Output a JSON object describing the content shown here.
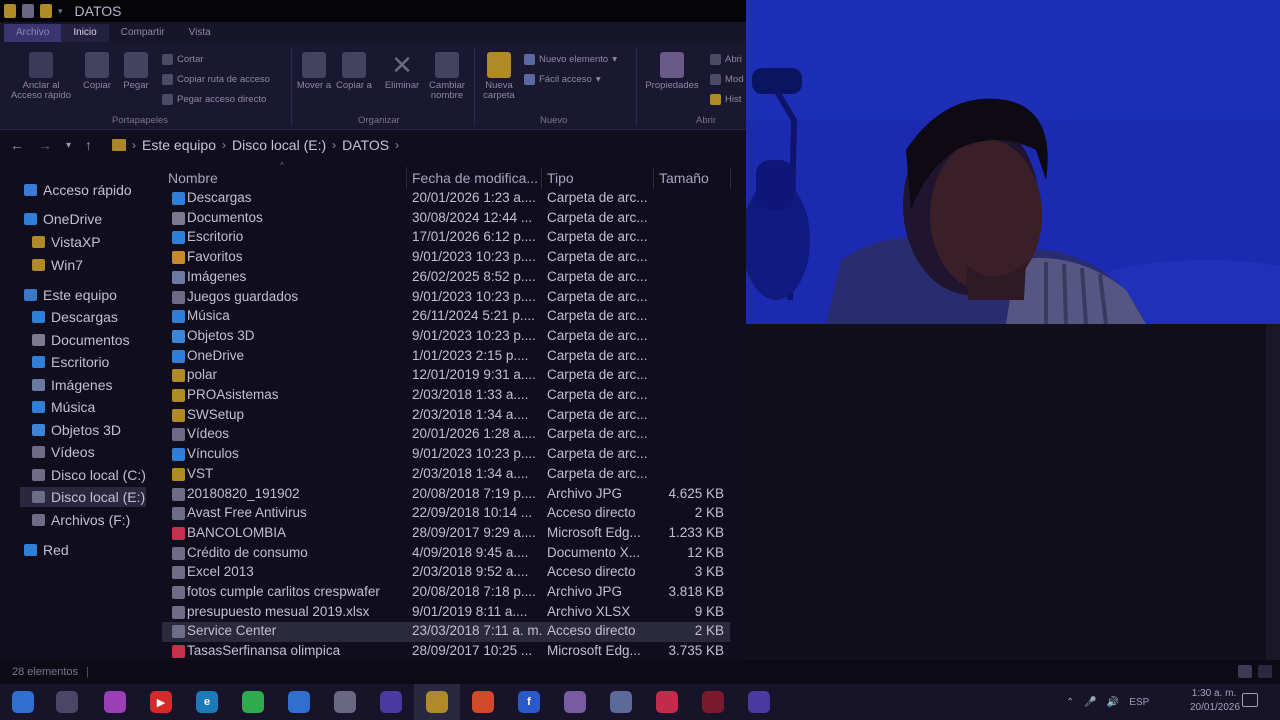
{
  "window": {
    "title": "DATOS"
  },
  "ribbon_tabs": [
    "Archivo",
    "Inicio",
    "Compartir",
    "Vista"
  ],
  "ribbon": {
    "anclar": "Anclar al Acceso rápido",
    "copiar": "Copiar",
    "pegar": "Pegar",
    "cortar": "Cortar",
    "copiar_ruta": "Copiar ruta de acceso",
    "pegar_acceso": "Pegar acceso directo",
    "grupo_portapapeles": "Portapapeles",
    "mover": "Mover a",
    "copiar_a": "Copiar a",
    "eliminar": "Eliminar",
    "cambiar": "Cambiar nombre",
    "grupo_organizar": "Organizar",
    "nueva_carpeta": "Nueva carpeta",
    "nuevo_elemento": "Nuevo elemento",
    "facil_acceso": "Fácil acceso",
    "grupo_nuevo": "Nuevo",
    "propiedades": "Propiedades",
    "abrir_small": "Abri",
    "modificar_small": "Mod",
    "historial_small": "Hist",
    "grupo_abrir": "Abrir"
  },
  "breadcrumb": [
    "Este equipo",
    "Disco local (E:)",
    "DATOS"
  ],
  "nav": [
    {
      "label": "Acceso rápido",
      "icon": "star-icon",
      "color": "#3a7bd5"
    },
    {
      "label": "OneDrive",
      "icon": "cloud-icon",
      "color": "#2f7fd8"
    },
    {
      "label": "VistaXP",
      "icon": "folder-icon",
      "color": "#b08a26"
    },
    {
      "label": "Win7",
      "icon": "folder-icon",
      "color": "#b08a26"
    },
    {
      "label": "Este equipo",
      "icon": "computer-icon",
      "color": "#3a78c8"
    },
    {
      "label": "Descargas",
      "icon": "download-icon",
      "color": "#2f7fd8"
    },
    {
      "label": "Documentos",
      "icon": "document-icon",
      "color": "#7b7892"
    },
    {
      "label": "Escritorio",
      "icon": "desktop-icon",
      "color": "#2f7fd8"
    },
    {
      "label": "Imágenes",
      "icon": "image-icon",
      "color": "#6b7aa0"
    },
    {
      "label": "Música",
      "icon": "music-icon",
      "color": "#2f7fd8"
    },
    {
      "label": "Objetos 3D",
      "icon": "cube-icon",
      "color": "#3b86d8"
    },
    {
      "label": "Vídeos",
      "icon": "video-icon",
      "color": "#6c6a86"
    },
    {
      "label": "Disco local (C:)",
      "icon": "drive-icon",
      "color": "#6f6c88"
    },
    {
      "label": "Disco local (E:)",
      "icon": "drive-icon",
      "color": "#6f6c88"
    },
    {
      "label": "Archivos (F:)",
      "icon": "drive-icon",
      "color": "#6f6c88"
    },
    {
      "label": "Red",
      "icon": "network-icon",
      "color": "#2f7fd8"
    }
  ],
  "columns": {
    "name": "Nombre",
    "date": "Fecha de modifica...",
    "type": "Tipo",
    "size": "Tamaño"
  },
  "files": [
    {
      "name": "Descargas",
      "date": "20/01/2026 1:23 a....",
      "type": "Carpeta de arc...",
      "size": "",
      "icon": "download-icon",
      "color": "#2f7fd8"
    },
    {
      "name": "Documentos",
      "date": "30/08/2024 12:44 ...",
      "type": "Carpeta de arc...",
      "size": "",
      "icon": "document-icon",
      "color": "#7b7892"
    },
    {
      "name": "Escritorio",
      "date": "17/01/2026 6:12 p....",
      "type": "Carpeta de arc...",
      "size": "",
      "icon": "desktop-icon",
      "color": "#2f7fd8"
    },
    {
      "name": "Favoritos",
      "date": "9/01/2023 10:23 p....",
      "type": "Carpeta de arc...",
      "size": "",
      "icon": "star-icon",
      "color": "#c8892a"
    },
    {
      "name": "Imágenes",
      "date": "26/02/2025 8:52 p....",
      "type": "Carpeta de arc...",
      "size": "",
      "icon": "image-icon",
      "color": "#6b7aa0"
    },
    {
      "name": "Juegos guardados",
      "date": "9/01/2023 10:23 p....",
      "type": "Carpeta de arc...",
      "size": "",
      "icon": "game-icon",
      "color": "#6c6a86"
    },
    {
      "name": "Música",
      "date": "26/11/2024 5:21 p....",
      "type": "Carpeta de arc...",
      "size": "",
      "icon": "music-icon",
      "color": "#2f7fd8"
    },
    {
      "name": "Objetos 3D",
      "date": "9/01/2023 10:23 p....",
      "type": "Carpeta de arc...",
      "size": "",
      "icon": "cube-icon",
      "color": "#3b86d8"
    },
    {
      "name": "OneDrive",
      "date": "1/01/2023 2:15 p....",
      "type": "Carpeta de arc...",
      "size": "",
      "icon": "cloud-icon",
      "color": "#2f7fd8"
    },
    {
      "name": "polar",
      "date": "12/01/2019 9:31 a....",
      "type": "Carpeta de arc...",
      "size": "",
      "icon": "folder-icon",
      "color": "#b08a26"
    },
    {
      "name": "PROAsistemas",
      "date": "2/03/2018 1:33 a....",
      "type": "Carpeta de arc...",
      "size": "",
      "icon": "folder-icon",
      "color": "#b08a26"
    },
    {
      "name": "SWSetup",
      "date": "2/03/2018 1:34 a....",
      "type": "Carpeta de arc...",
      "size": "",
      "icon": "folder-icon",
      "color": "#b08a26"
    },
    {
      "name": "Vídeos",
      "date": "20/01/2026 1:28 a....",
      "type": "Carpeta de arc...",
      "size": "",
      "icon": "video-icon",
      "color": "#6c6a86"
    },
    {
      "name": "Vínculos",
      "date": "9/01/2023 10:23 p....",
      "type": "Carpeta de arc...",
      "size": "",
      "icon": "link-icon",
      "color": "#2f7fd8"
    },
    {
      "name": "VST",
      "date": "2/03/2018 1:34 a....",
      "type": "Carpeta de arc...",
      "size": "",
      "icon": "folder-icon",
      "color": "#b08a26"
    },
    {
      "name": "20180820_191902",
      "date": "20/08/2018 7:19 p....",
      "type": "Archivo JPG",
      "size": "4.625 KB",
      "icon": "image-file-icon",
      "color": "#6f6c88"
    },
    {
      "name": "Avast Free Antivirus",
      "date": "22/09/2018 10:14 ...",
      "type": "Acceso directo",
      "size": "2 KB",
      "icon": "shortcut-icon",
      "color": "#6f6c88"
    },
    {
      "name": "BANCOLOMBIA",
      "date": "28/09/2017 9:29 a....",
      "type": "Microsoft Edg...",
      "size": "1.233 KB",
      "icon": "pdf-icon",
      "color": "#c4314b"
    },
    {
      "name": "Crédito de consumo",
      "date": "4/09/2018 9:45 a....",
      "type": "Documento X...",
      "size": "12 KB",
      "icon": "document-icon",
      "color": "#6f6c88"
    },
    {
      "name": "Excel 2013",
      "date": "2/03/2018 9:52 a....",
      "type": "Acceso directo",
      "size": "3 KB",
      "icon": "shortcut-icon",
      "color": "#6f6c88"
    },
    {
      "name": "fotos cumple carlitos crespwafer",
      "date": "20/08/2018 7:18 p....",
      "type": "Archivo JPG",
      "size": "3.818 KB",
      "icon": "image-file-icon",
      "color": "#6f6c88"
    },
    {
      "name": "presupuesto mesual 2019.xlsx",
      "date": "9/01/2019 8:11 a....",
      "type": "Archivo XLSX",
      "size": "9 KB",
      "icon": "document-icon",
      "color": "#6f6c88"
    },
    {
      "name": "Service Center",
      "date": "23/03/2018 7:11 a. m.",
      "type": "Acceso directo",
      "size": "2 KB",
      "icon": "shortcut-icon",
      "color": "#6f6c88"
    },
    {
      "name": "TasasSerfinansa olimpica",
      "date": "28/09/2017 10:25 ...",
      "type": "Microsoft Edg...",
      "size": "3.735 KB",
      "icon": "pdf-icon",
      "color": "#c4314b"
    }
  ],
  "status": "28 elementos",
  "tray": {
    "lang": "ESP",
    "time": "1:30 a. m.",
    "date": "20/01/2026"
  },
  "taskbar_apps": [
    {
      "name": "start-icon",
      "color": "#2f6fd0",
      "glyph": ""
    },
    {
      "name": "task-view-icon",
      "color": "#4a4766",
      "glyph": ""
    },
    {
      "name": "photos-icon",
      "color": "#9a3fb5",
      "glyph": ""
    },
    {
      "name": "youtube-icon",
      "color": "#d42a2a",
      "glyph": "▶"
    },
    {
      "name": "edge-icon",
      "color": "#1b7bb8",
      "glyph": "e"
    },
    {
      "name": "whatsapp-icon",
      "color": "#2faa4c",
      "glyph": ""
    },
    {
      "name": "mail-icon",
      "color": "#2f6fd0",
      "glyph": ""
    },
    {
      "name": "store-icon",
      "color": "#6a6785",
      "glyph": ""
    },
    {
      "name": "premiere-icon",
      "color": "#4a3aa0",
      "glyph": ""
    },
    {
      "name": "file-explorer-icon",
      "color": "#b08a26",
      "glyph": ""
    },
    {
      "name": "chrome-icon",
      "color": "#d04a2a",
      "glyph": ""
    },
    {
      "name": "facebook-icon",
      "color": "#2a5ac8",
      "glyph": "f"
    },
    {
      "name": "usb-icon",
      "color": "#7a5aa0",
      "glyph": ""
    },
    {
      "name": "camera-icon",
      "color": "#5a6a9a",
      "glyph": ""
    },
    {
      "name": "tiktok-icon",
      "color": "#c42a4a",
      "glyph": ""
    },
    {
      "name": "obs-icon",
      "color": "#7a1a2a",
      "glyph": ""
    },
    {
      "name": "premiere-alt-icon",
      "color": "#4a3aa0",
      "glyph": ""
    }
  ]
}
